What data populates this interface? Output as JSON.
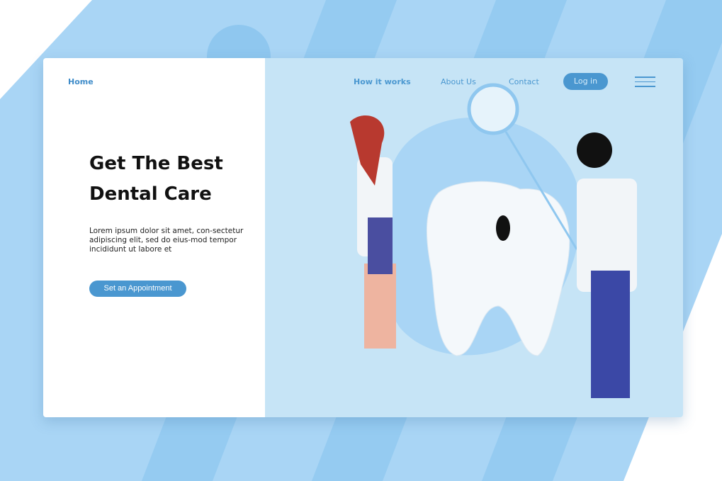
{
  "nav": {
    "home": "Home",
    "how_it_works": "How it works",
    "about": "About Us",
    "contact": "Contact",
    "login": "Log in",
    "menu_icon": "hamburger-menu-icon"
  },
  "hero": {
    "title_line1": "Get The Best",
    "title_line2": "Dental Care",
    "body": "Lorem ipsum dolor sit amet, con-sectetur adipiscing elit, sed do eius-mod tempor incididunt ut labore et",
    "cta": "Set an Appointment"
  },
  "colors": {
    "accent": "#4a97d0",
    "panel": "#c6e4f6",
    "background": "#a9d5f5"
  }
}
